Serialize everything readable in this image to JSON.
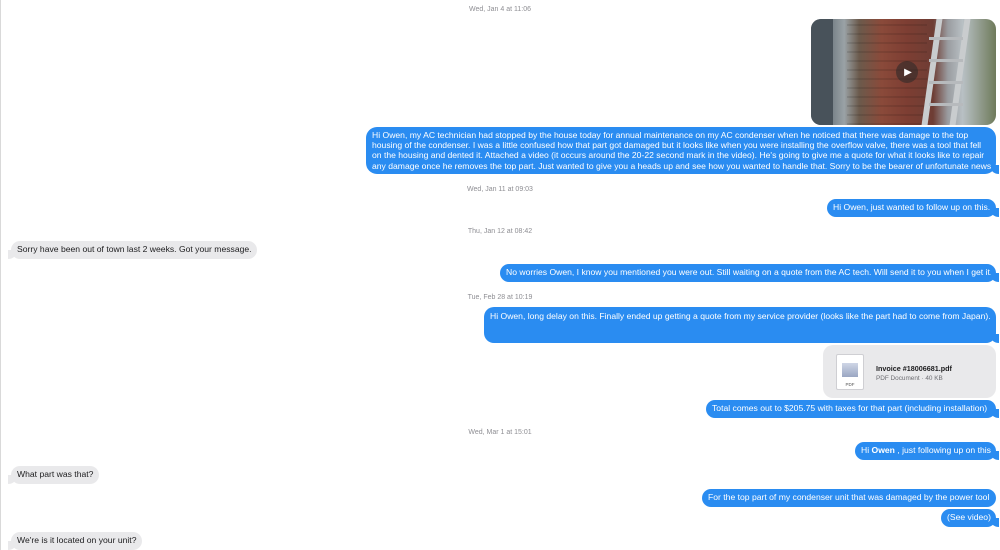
{
  "timestamps": {
    "t1": "Wed, Jan 4 at 11:06",
    "t2": "Wed, Jan 11 at 09:03",
    "t3": "Thu, Jan 12 at 08:42",
    "t4": "Tue, Feb 28 at 10:19",
    "t5": "Wed, Mar 1 at 15:01"
  },
  "video": {
    "icon": "play-icon"
  },
  "messages": {
    "m1": [
      "Hi Owen, my AC technician had stopped by the house today for annual maintenance on my AC condenser when he noticed that there was damage to the top",
      "housing of the condenser. I was a little confused how that part got damaged but it looks like when you were installing the overflow valve, there was a tool that fell",
      "on the housing and dented it. Attached a video (it occurs around the 20-22 second mark in the video). He's going to give me a quote for what it looks like to repair",
      "any damage once he removes the top part. Just wanted to give you a heads up and see how you wanted to handle that. Sorry to be the bearer of unfortunate news."
    ],
    "m2": "Hi Owen, just wanted to follow up on this.",
    "m3": "Sorry have been out of town last 2 weeks. Got your message.",
    "m4": "No worries Owen, I know you mentioned you were out. Still waiting on a quote from the AC tech. Will send it to you when I get it.",
    "m5": "Hi Owen, long delay on this. Finally ended up getting a quote from my service provider (looks like the part had to come from Japan).",
    "m6": "Total comes out to $205.75 with taxes for that part (including installation)",
    "m7_pre": "Hi ",
    "m7_name": "Owen",
    "m7_post": " , just following up on this",
    "m8": "What part was that?",
    "m9": "For the top part of my condenser unit that was damaged by the power tool",
    "m10": "(See video)",
    "m11": "We're is it located on your unit?"
  },
  "attachment": {
    "filename": "Invoice #18006681.pdf",
    "meta": "PDF Document · 40 KB",
    "thumb_label": "PDF",
    "icon": "pdf-file-icon"
  },
  "colors": {
    "outgoing_bubble": "#2a8cf1",
    "incoming_bubble": "#e9e9eb",
    "timestamp_text": "#8e8e93"
  }
}
